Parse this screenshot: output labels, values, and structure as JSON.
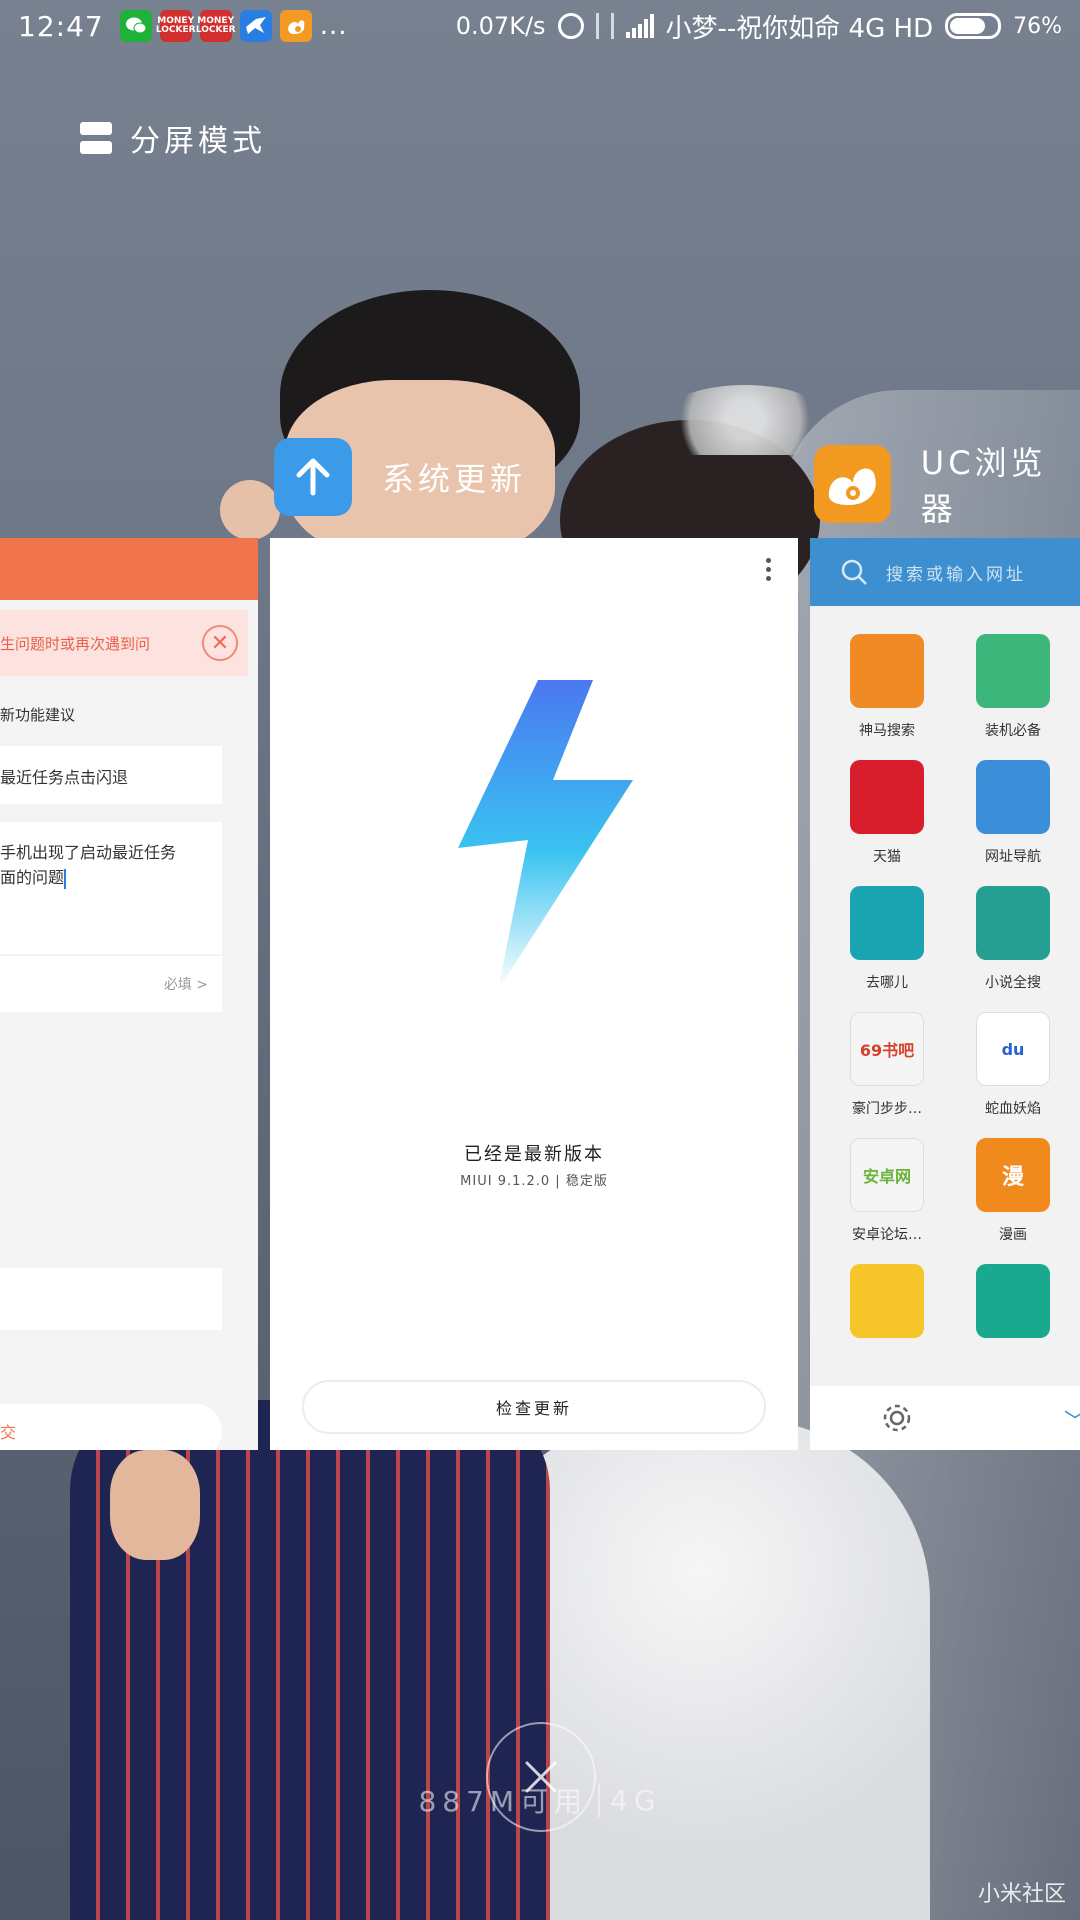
{
  "status_bar": {
    "time": "12:47",
    "notification_icons": [
      {
        "icon": "wechat-icon",
        "text": ""
      },
      {
        "icon": "money-locker-icon",
        "text": "MONEY LOCKER"
      },
      {
        "icon": "money-locker-icon",
        "text": "MONEY LOCKER"
      },
      {
        "icon": "bird-icon",
        "text": ""
      },
      {
        "icon": "uc-browser-icon",
        "text": ""
      }
    ],
    "more": "...",
    "net_speed": "0.07K/s",
    "carrier": "小梦--祝你如命 4G HD",
    "battery_percent": "76%",
    "battery_level": 0.76
  },
  "split_screen": {
    "label": "分屏模式"
  },
  "recent_apps": {
    "center": {
      "name": "系统更新",
      "icon": "arrow-up-icon",
      "icon_color": "#3b9be8"
    },
    "right": {
      "name": "UC浏览器",
      "icon": "uc-squirrel-icon",
      "icon_color": "#f29a1f"
    }
  },
  "feedback_card": {
    "notice": "生问题时或再次遇到问",
    "label": "新功能建议",
    "title_value": "最近任务点击闪退",
    "description_line1": "手机出现了启动最近任务",
    "description_line2": "面的问题",
    "required_row": "必填 >",
    "submit": "交"
  },
  "update_card": {
    "status": "已经是最新版本",
    "version": "MIUI 9.1.2.0 | 稳定版",
    "check_button": "检查更新"
  },
  "browser_card": {
    "search_placeholder": "搜索或输入网址",
    "apps": [
      {
        "label": "神马搜索",
        "icon": "alpaca-icon",
        "color": "#f08a24",
        "glyph": ""
      },
      {
        "label": "装机必备",
        "icon": "shopping-bag-icon",
        "color": "#3cb67a",
        "glyph": ""
      },
      {
        "label": "天猫",
        "icon": "tmall-icon",
        "color": "#d81e2c",
        "glyph": ""
      },
      {
        "label": "网址导航",
        "icon": "compass-icon",
        "color": "#3b8fd9",
        "glyph": ""
      },
      {
        "label": "去哪儿",
        "icon": "camel-icon",
        "color": "#1aa3b0",
        "glyph": ""
      },
      {
        "label": "小说全搜",
        "icon": "book-icon",
        "color": "#25a090",
        "glyph": ""
      },
      {
        "label": "豪门步步…",
        "icon": "69-book-icon",
        "color": "#f5f5f5",
        "glyph": "69书吧"
      },
      {
        "label": "蛇血妖焰",
        "icon": "baidu-icon",
        "color": "#ffffff",
        "glyph": "du"
      },
      {
        "label": "安卓论坛…",
        "icon": "anzhuo-icon",
        "color": "#f5f5f5",
        "glyph": "安卓网"
      },
      {
        "label": "漫画",
        "icon": "manga-icon",
        "color": "#f08a1c",
        "glyph": "漫"
      },
      {
        "label": "",
        "icon": "smiley-icon",
        "color": "#f5c52a",
        "glyph": ""
      },
      {
        "label": "",
        "icon": "location-icon",
        "color": "#1aa88f",
        "glyph": ""
      }
    ]
  },
  "bottom": {
    "memory_free": "887M可用",
    "memory_total": "4G",
    "watermark": "小米社区"
  }
}
